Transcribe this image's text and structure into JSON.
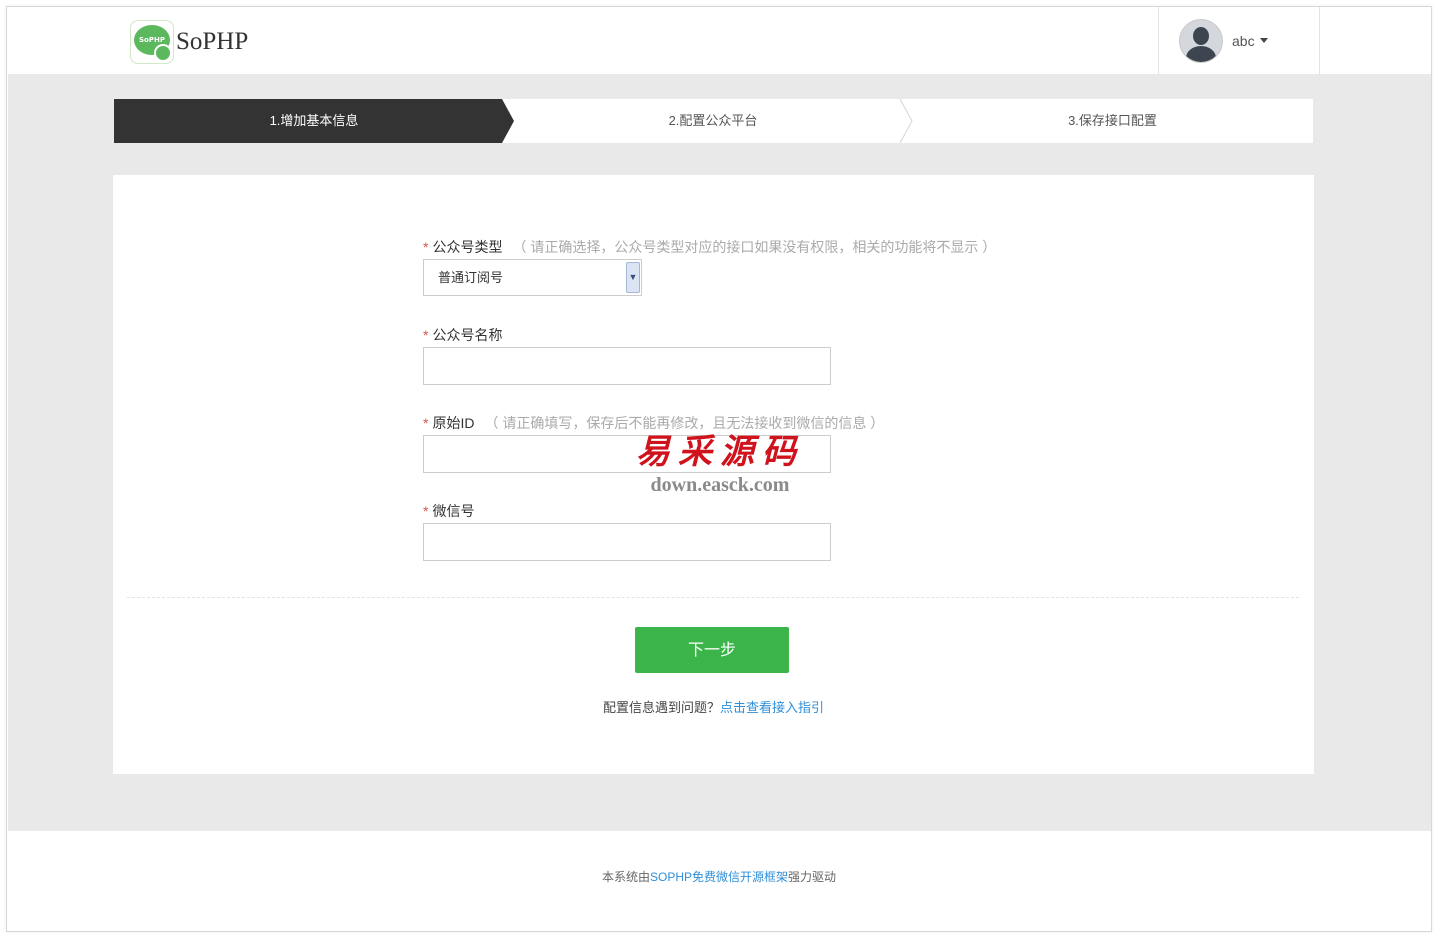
{
  "header": {
    "logo_text": "SoPHP",
    "logo_mark_text": "SoPHP",
    "username": "abc"
  },
  "steps": [
    {
      "label": "1.增加基本信息",
      "active": true
    },
    {
      "label": "2.配置公众平台",
      "active": false
    },
    {
      "label": "3.保存接口配置",
      "active": false
    }
  ],
  "form": {
    "account_type": {
      "label": "公众号类型",
      "hint": "（ 请正确选择，公众号类型对应的接口如果没有权限，相关的功能将不显示 ）",
      "selected": "普通订阅号"
    },
    "account_name": {
      "label": "公众号名称",
      "value": ""
    },
    "original_id": {
      "label": "原始ID",
      "hint": "（ 请正确填写，保存后不能再修改，且无法接收到微信的信息 ）",
      "value": ""
    },
    "wechat_id": {
      "label": "微信号",
      "value": ""
    },
    "required_mark": "*",
    "next_label": "下一步",
    "help_text": "配置信息遇到问题？",
    "help_link": "点击查看接入指引"
  },
  "watermark": {
    "cn": "易采源码",
    "en": "down.easck.com"
  },
  "footer": {
    "prefix": "本系统由",
    "link": "SOPHP免费微信开源框架",
    "suffix": "强力驱动"
  },
  "colors": {
    "active_step": "#333333",
    "primary_button": "#3bb54a",
    "link": "#2f8fd8",
    "required": "#d9534f",
    "page_bg": "#e9e9e9"
  }
}
